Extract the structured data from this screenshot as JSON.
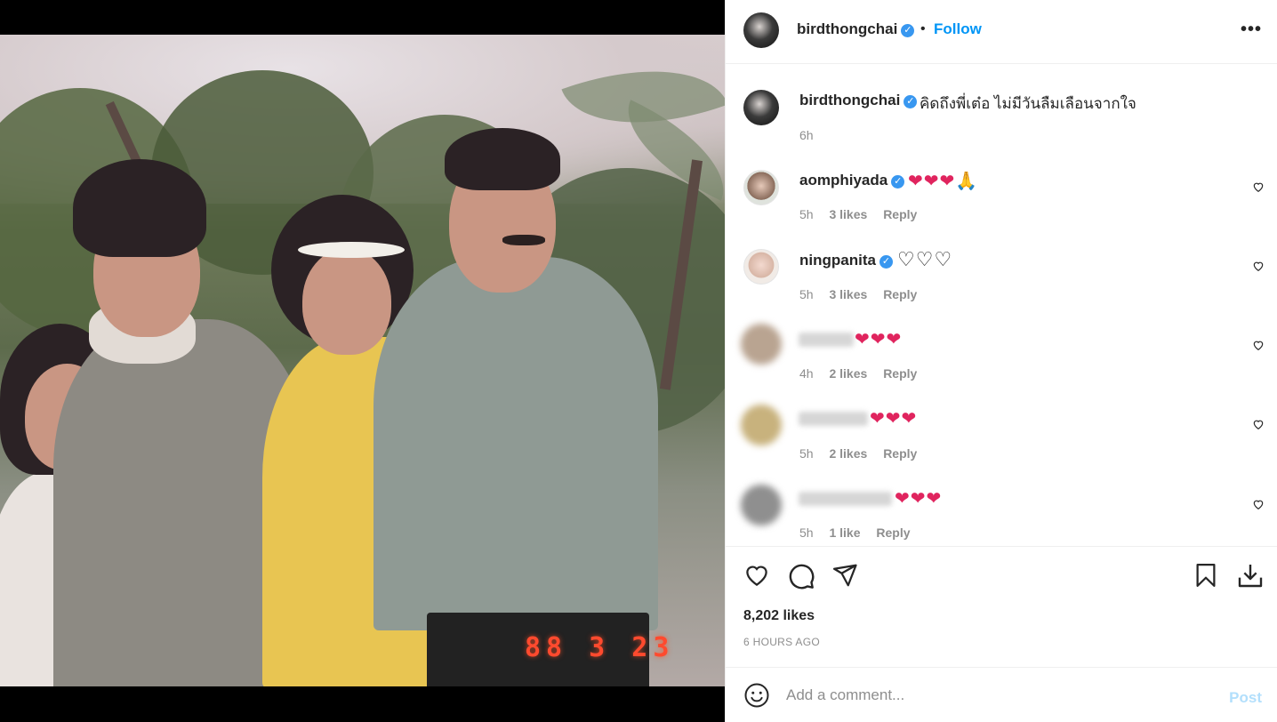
{
  "post": {
    "author": "birdthongchai",
    "follow_label": "Follow",
    "separator": "•",
    "more_label": "•••",
    "caption": "คิดถึงพี่เต๋อ ไม่มีวันลืมเลือนจากใจ",
    "caption_time": "6h",
    "photo_date_stamp": "88  3 23",
    "likes": "8,202 likes",
    "time_ago": "6 HOURS AGO"
  },
  "comments": [
    {
      "user": "aomphiyada",
      "verified": true,
      "text": "❤❤❤🙏",
      "time": "5h",
      "likes": "3 likes",
      "reply": "Reply",
      "style": "red"
    },
    {
      "user": "ningpanita",
      "verified": true,
      "text": "♡♡♡",
      "time": "5h",
      "likes": "3 likes",
      "reply": "Reply",
      "style": "outline"
    },
    {
      "user": "",
      "verified": false,
      "text": "❤❤❤",
      "time": "4h",
      "likes": "2 likes",
      "reply": "Reply",
      "style": "red"
    },
    {
      "user": "",
      "verified": false,
      "text": "❤❤❤",
      "time": "5h",
      "likes": "2 likes",
      "reply": "Reply",
      "style": "red"
    },
    {
      "user": "",
      "verified": false,
      "text": "❤❤❤",
      "time": "5h",
      "likes": "1 like",
      "reply": "Reply",
      "style": "red"
    }
  ],
  "composer": {
    "placeholder": "Add a comment...",
    "post_label": "Post"
  },
  "colors": {
    "link_blue": "#0095f6",
    "verified_blue": "#3897f0",
    "heart_red": "#e0245e",
    "muted": "#8e8e8e"
  }
}
